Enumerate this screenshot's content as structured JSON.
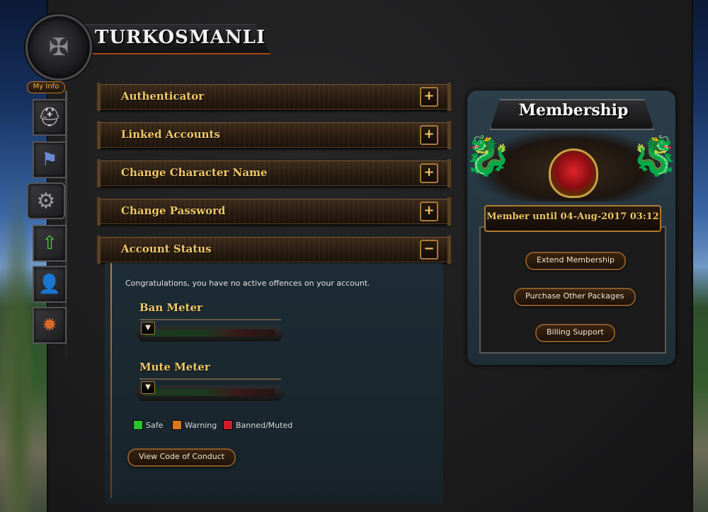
{
  "brand": {
    "name": "TURKOSMANLI"
  },
  "nav": {
    "my_info_label": "My Info",
    "items": [
      {
        "id": "character",
        "icon": "helmet-icon"
      },
      {
        "id": "clan",
        "icon": "banner-icon"
      },
      {
        "id": "settings",
        "icon": "gear-icon"
      },
      {
        "id": "upgrade",
        "icon": "upgrade-arrow-icon"
      },
      {
        "id": "add-friend",
        "icon": "add-user-icon"
      },
      {
        "id": "support",
        "icon": "medallion-icon"
      }
    ]
  },
  "accordion": {
    "sections": [
      {
        "label": "Authenticator",
        "toggle": "+"
      },
      {
        "label": "Linked Accounts",
        "toggle": "+"
      },
      {
        "label": "Change Character Name",
        "toggle": "+"
      },
      {
        "label": "Change Password",
        "toggle": "+"
      },
      {
        "label": "Account Status",
        "toggle": "−"
      }
    ]
  },
  "account_status": {
    "message": "Congratulations, you have no active offences on your account.",
    "ban_meter": {
      "title": "Ban Meter",
      "level": 0
    },
    "mute_meter": {
      "title": "Mute Meter",
      "level": 0
    },
    "legend": [
      {
        "label": "Safe",
        "color": "#2fbf2f"
      },
      {
        "label": "Warning",
        "color": "#d8791c"
      },
      {
        "label": "Banned/Muted",
        "color": "#d21c2a"
      }
    ],
    "conduct_button": "View Code of Conduct"
  },
  "membership": {
    "title": "Membership",
    "until": "Member until 04-Aug-2017 03:12",
    "buttons": {
      "extend": "Extend Membership",
      "purchase": "Purchase Other Packages",
      "billing": "Billing Support"
    }
  },
  "colors": {
    "gold_text": "#f0c868",
    "accent_orange": "#c67c2e"
  }
}
